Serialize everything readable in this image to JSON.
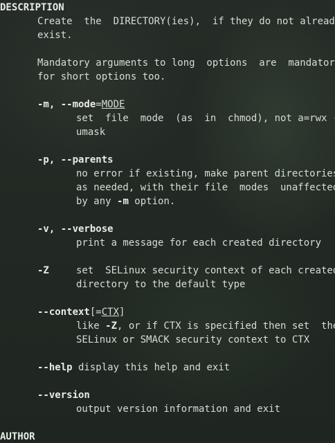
{
  "manpage": {
    "heading_description": "DESCRIPTION",
    "heading_author": "AUTHOR",
    "intro": {
      "line1": "Create  the  DIRECTORY(ies),  if they do not already",
      "line2": "exist."
    },
    "mandatory": {
      "line1": "Mandatory arguments to long  options  are  mandatory",
      "line2": "for short options too."
    },
    "mode": {
      "flag": "-m, --mode",
      "eq": "=",
      "arg": "MODE",
      "desc1": "set  file  mode  (as  in  chmod), not a=rwx -",
      "desc2": "umask"
    },
    "parents": {
      "flag": "-p, --parents",
      "desc1": "no error if existing, make parent directories",
      "desc2": "as needed, with their file  modes  unaffected",
      "desc3_pre": "by any ",
      "desc3_flag": "-m",
      "desc3_post": " option."
    },
    "verbose": {
      "flag": "-v, --verbose",
      "desc1": "print a message for each created directory"
    },
    "selinux": {
      "flag": "-Z",
      "desc1": "set  SELinux security context of each created",
      "desc2": "directory to the default type"
    },
    "context": {
      "flag": "--context",
      "open": "[=",
      "arg": "CTX",
      "close": "]",
      "desc1_pre": "like ",
      "desc1_flag": "-Z",
      "desc1_post": ", or if CTX is specified then set  the",
      "desc2": "SELinux or SMACK security context to CTX"
    },
    "help": {
      "flag": "--help",
      "desc1": " display this help and exit"
    },
    "version": {
      "flag": "--version",
      "desc1": "output version information and exit"
    }
  }
}
